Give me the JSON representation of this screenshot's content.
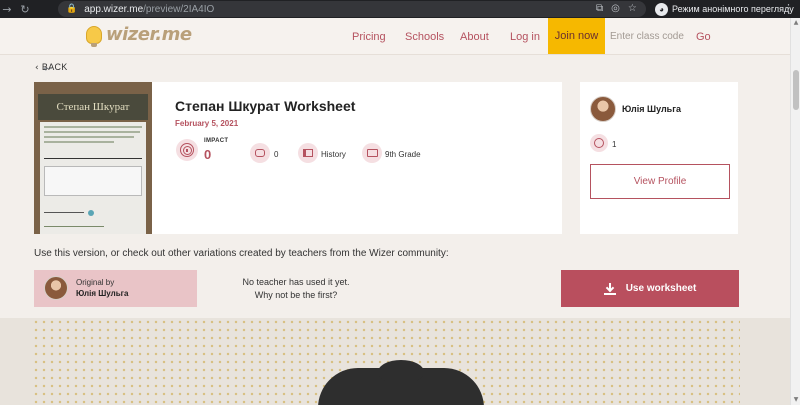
{
  "browser": {
    "url_host": "app.wizer.me",
    "url_path": "/preview/2IA4IO",
    "incognito_label": "Режим анонімного перегляду"
  },
  "header": {
    "logo_text": "wizer.me",
    "nav": [
      "Pricing",
      "Schools",
      "About",
      "Log in"
    ],
    "join_label": "Join now",
    "class_code_placeholder": "Enter class code",
    "go_label": "Go"
  },
  "back_label": "BACK",
  "worksheet": {
    "title": "Степан Шкурат Worksheet",
    "date": "February 5, 2021",
    "thumbnail_heading": "Степан Шкурат",
    "impact_label": "IMPACT",
    "impact_value": "0",
    "comments": "0",
    "subject": "History",
    "grade": "9th Grade"
  },
  "author": {
    "name": "Юлія Шульга",
    "impact_value": "1",
    "view_profile_label": "View Profile"
  },
  "variations": {
    "intro": "Use this version, or check out other variations created by teachers from the Wizer community:",
    "original_by_label": "Original by",
    "original_author": "Юлія Шульга",
    "no_teacher_text": "No teacher has used it yet. Why not be the first?",
    "use_button_label": "Use worksheet"
  },
  "colors": {
    "brand": "#b5525f",
    "join": "#f6b800",
    "use_button": "#b94f5e",
    "original_box": "#e9c4c7"
  }
}
